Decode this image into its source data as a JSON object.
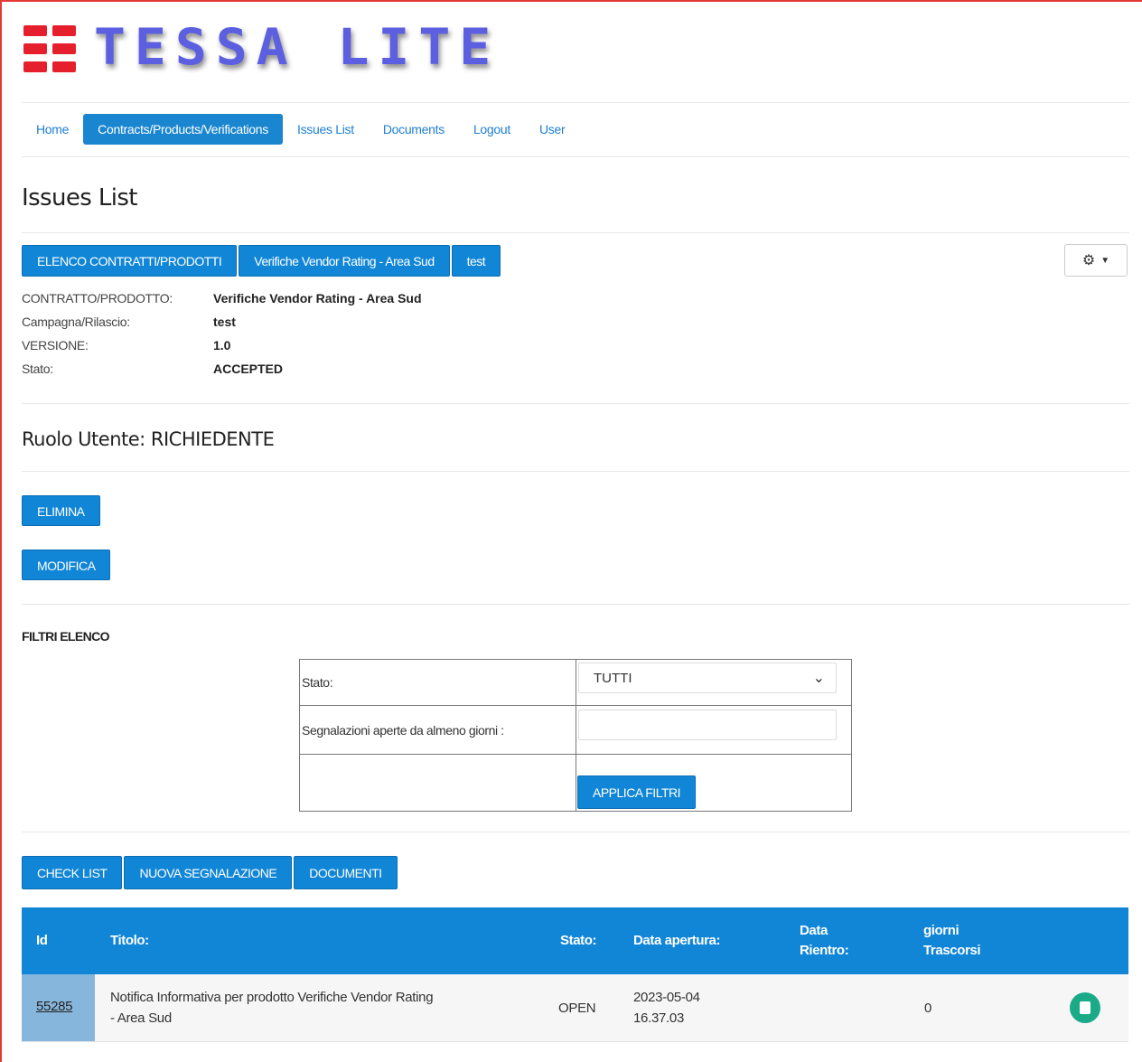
{
  "app": {
    "logo_text": "TESSA LITE"
  },
  "nav": {
    "items": [
      {
        "label": "Home"
      },
      {
        "label": "Contracts/Products/Verifications"
      },
      {
        "label": "Issues List"
      },
      {
        "label": "Documents"
      },
      {
        "label": "Logout"
      },
      {
        "label": "User"
      }
    ],
    "active": "Contracts/Products/Verifications"
  },
  "page": {
    "title": "Issues List"
  },
  "breadcrumb": [
    {
      "label": "ELENCO CONTRATTI/PRODOTTI"
    },
    {
      "label": "Verifiche Vendor Rating - Area Sud"
    },
    {
      "label": "test"
    }
  ],
  "settings": {
    "icon": "gear-icon",
    "caret_icon": "caret-down-icon"
  },
  "details": {
    "contratto_label": "CONTRATTO/PRODOTTO:",
    "contratto_value": "Verifiche Vendor Rating - Area Sud",
    "campagna_label": "Campagna/Rilascio:",
    "campagna_value": "test",
    "versione_label": "VERSIONE:",
    "versione_value": "1.0",
    "stato_label": "Stato:",
    "stato_value": "ACCEPTED"
  },
  "role": {
    "text": "Ruolo Utente: RICHIEDENTE"
  },
  "buttons": {
    "elimina": "ELIMINA",
    "modifica": "MODIFICA"
  },
  "filters": {
    "heading": "FILTRI ELENCO",
    "stato_label": "Stato:",
    "stato_selected": "TUTTI",
    "giorni_label": "Segnalazioni aperte da almeno giorni :",
    "giorni_value": "",
    "apply_label": "APPLICA FILTRI"
  },
  "actions": {
    "checklist": "CHECK LIST",
    "nuova": "NUOVA SEGNALAZIONE",
    "documenti": "DOCUMENTI"
  },
  "table": {
    "headers": {
      "id": "Id",
      "titolo": "Titolo:",
      "stato": "Stato:",
      "data_apertura": "Data apertura:",
      "data_rientro_1": "Data",
      "data_rientro_2": "Rientro:",
      "giorni_1": "giorni",
      "giorni_2": "Trascorsi"
    },
    "rows": [
      {
        "id": "55285",
        "titolo_1": "Notifica Informativa per prodotto Verifiche Vendor Rating",
        "titolo_2": "- Area Sud",
        "stato": "OPEN",
        "data_apertura_1": "2023-05-04",
        "data_apertura_2": "16.37.03",
        "data_rientro": "",
        "giorni": "0",
        "action_icon": "document-icon"
      }
    ]
  },
  "colors": {
    "primary": "#1186d6",
    "brand_red": "#e5202c",
    "logo_purple": "#5b5fe0",
    "row_id_bg": "#87b6dc",
    "icon_green": "#1aaa88"
  }
}
